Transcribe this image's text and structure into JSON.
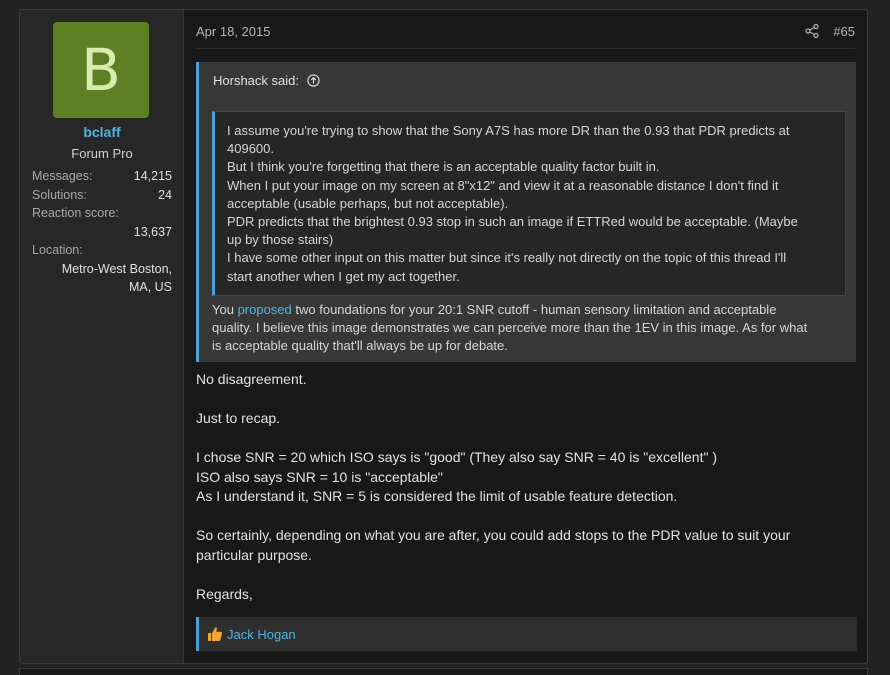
{
  "user": {
    "avatar_letter": "B",
    "username": "bclaff",
    "title": "Forum Pro",
    "messages_label": "Messages:",
    "messages": "14,215",
    "solutions_label": "Solutions:",
    "solutions": "24",
    "reaction_label": "Reaction score:",
    "reaction": "13,637",
    "location_label": "Location:",
    "location_line1": "Metro-West Boston,",
    "location_line2": "MA, US"
  },
  "post": {
    "date": "Apr 18, 2015",
    "number": "#65"
  },
  "quote": {
    "author": "Horshack said:",
    "inner_lines": [
      "I assume you're trying to show that the Sony A7S has more DR than the 0.93 that PDR predicts at",
      "409600.",
      "But I think you're forgetting that there is an acceptable quality factor built in.",
      "When I put your image on my screen at 8\"x12\" and view it at a reasonable distance I don't find it",
      "acceptable (usable perhaps, but not acceptable).",
      "PDR predicts that the brightest 0.93 stop in such an image if ETTRed would be acceptable. (Maybe",
      "up by those stairs)",
      "I have some other input on this matter but since it's really not directly on the topic of this thread I'll",
      "start another when I get my act together."
    ],
    "tail_pre": "You ",
    "tail_link": "proposed",
    "tail_line1_rest": " two foundations for your 20:1 SNR cutoff - human sensory limitation and acceptable",
    "tail_line2": "quality. I believe this image demonstrates we can perceive more than the 1EV in this image. As for what",
    "tail_line3": "is acceptable quality that'll always be up for debate."
  },
  "body": {
    "p1": "No disagreement.",
    "p2": "Just to recap.",
    "p3_l1": "I chose SNR = 20 which ISO says is \"good\" (They also say SNR = 40 is \"excellent\" )",
    "p3_l2": "ISO also says SNR = 10 is \"acceptable\"",
    "p3_l3": "As I understand it, SNR = 5 is considered the limit of usable feature detection.",
    "p4_l1": "So certainly, depending on what you are after, you could add stops to the PDR value to suit your",
    "p4_l2": "particular purpose.",
    "p5": "Regards,"
  },
  "reactions": {
    "icon": "thumbs-up-icon",
    "user": "Jack Hogan"
  },
  "colors": {
    "accent": "#4a9fd8",
    "link": "#4fb3e0",
    "avatar_bg": "#5f7f24",
    "like_icon": "#f0a830"
  }
}
